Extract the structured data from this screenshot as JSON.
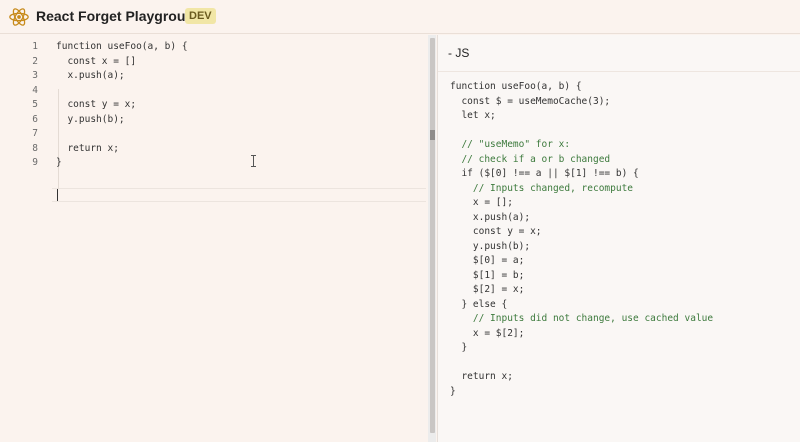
{
  "header": {
    "title": "React Forget Playground",
    "badge": "DEV"
  },
  "editor": {
    "line_numbers": [
      "1",
      "2",
      "3",
      "4",
      "5",
      "6",
      "7",
      "8",
      "9"
    ],
    "lines": [
      "function useFoo(a, b) {",
      "  const x = []",
      "  x.push(a);",
      "",
      "  const y = x;",
      "  y.push(b);",
      "",
      "  return x;",
      "}"
    ]
  },
  "output": {
    "tab_label": "- JS",
    "lines": [
      "function useFoo(a, b) {",
      "  const $ = useMemoCache(3);",
      "  let x;",
      "",
      "  // \"useMemo\" for x:",
      "  // check if a or b changed",
      "  if ($[0] !== a || $[1] !== b) {",
      "    // Inputs changed, recompute",
      "    x = [];",
      "    x.push(a);",
      "    const y = x;",
      "    y.push(b);",
      "    $[0] = a;",
      "    $[1] = b;",
      "    $[2] = x;",
      "  } else {",
      "    // Inputs did not change, use cached value",
      "    x = $[2];",
      "  }",
      "",
      "  return x;",
      "}"
    ]
  },
  "colors": {
    "background": "#fbf3ee",
    "keyword": "#2f57a8",
    "comment": "#3d7a3d",
    "badge_bg": "#f1e6a6"
  },
  "icons": {
    "logo": "react-atom-icon"
  }
}
